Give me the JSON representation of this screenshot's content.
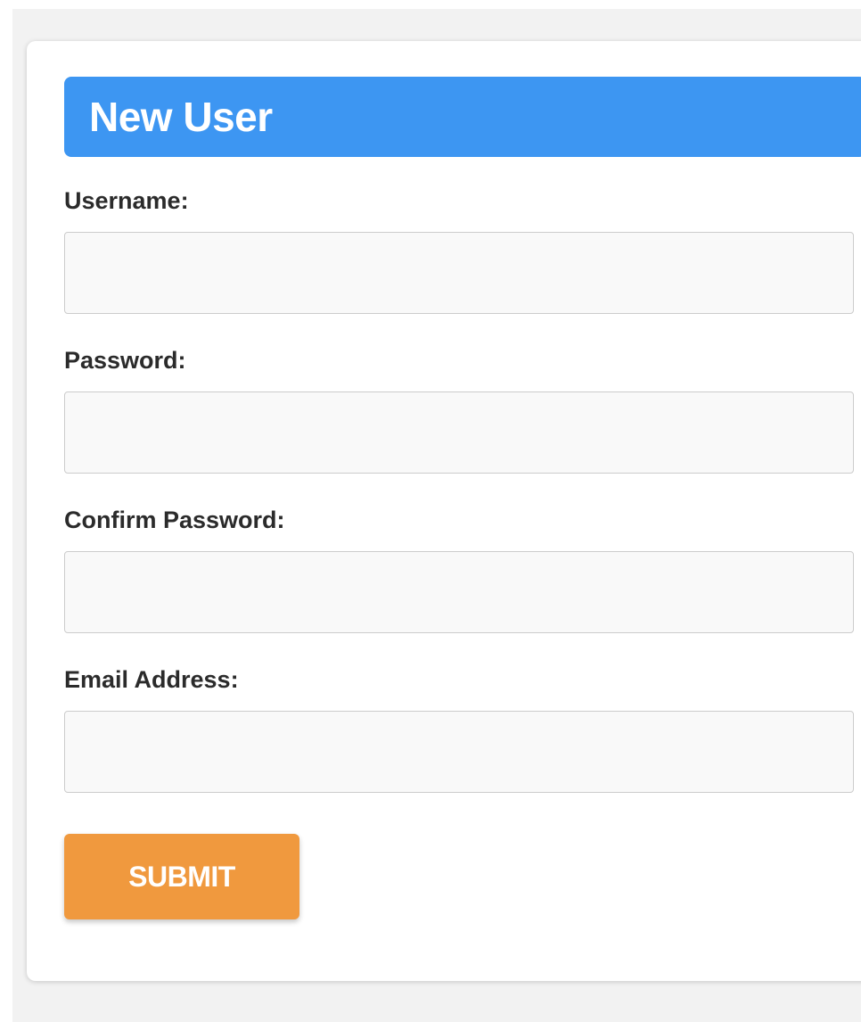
{
  "form": {
    "title": "New User",
    "fields": [
      {
        "label": "Username:",
        "value": "",
        "placeholder": ""
      },
      {
        "label": "Password:",
        "value": "",
        "placeholder": ""
      },
      {
        "label": "Confirm Password:",
        "value": "",
        "placeholder": ""
      },
      {
        "label": "Email Address:",
        "value": "",
        "placeholder": ""
      }
    ],
    "submit_label": "SUBMIT"
  },
  "colors": {
    "header_bg": "#3d96f2",
    "submit_bg": "#f0993e",
    "page_bg": "#f2f2f2"
  }
}
